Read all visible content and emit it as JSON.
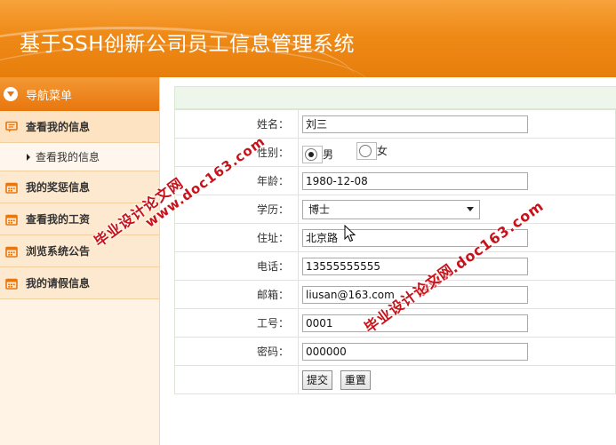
{
  "header": {
    "title": "基于SSH创新公司员工信息管理系统"
  },
  "sidebar": {
    "nav_title": "导航菜单",
    "items": [
      {
        "label": "查看我的信息",
        "icon": "message-icon",
        "sub": [
          "查看我的信息"
        ]
      },
      {
        "label": "我的奖惩信息",
        "icon": "calendar-icon"
      },
      {
        "label": "查看我的工资",
        "icon": "calendar-icon"
      },
      {
        "label": "浏览系统公告",
        "icon": "calendar-icon"
      },
      {
        "label": "我的请假信息",
        "icon": "calendar-icon"
      }
    ]
  },
  "form": {
    "name": {
      "label": "姓名：",
      "value": "刘三"
    },
    "gender": {
      "label": "性别：",
      "options": [
        "男",
        "女"
      ],
      "selected": "男"
    },
    "age": {
      "label": "年龄：",
      "value": "1980-12-08"
    },
    "education": {
      "label": "学历：",
      "value": "博士"
    },
    "address": {
      "label": "住址：",
      "value": "北京路"
    },
    "phone": {
      "label": "电话：",
      "value": "13555555555"
    },
    "email": {
      "label": "邮箱：",
      "value": "liusan@163.com"
    },
    "employee_no": {
      "label": "工号：",
      "value": "0001"
    },
    "password": {
      "label": "密码：",
      "value": "000000"
    },
    "submit_label": "提交",
    "reset_label": "重置"
  },
  "watermarks": {
    "site": "www.doc163.com",
    "brand": "毕业设计论文网"
  },
  "colors": {
    "header_orange": "#ef8a17",
    "sidebar_bg": "#fff3e6",
    "menu_item_bg": "#fde9cf",
    "form_header_green": "#eef6ec",
    "watermark_red": "#c8121a"
  }
}
